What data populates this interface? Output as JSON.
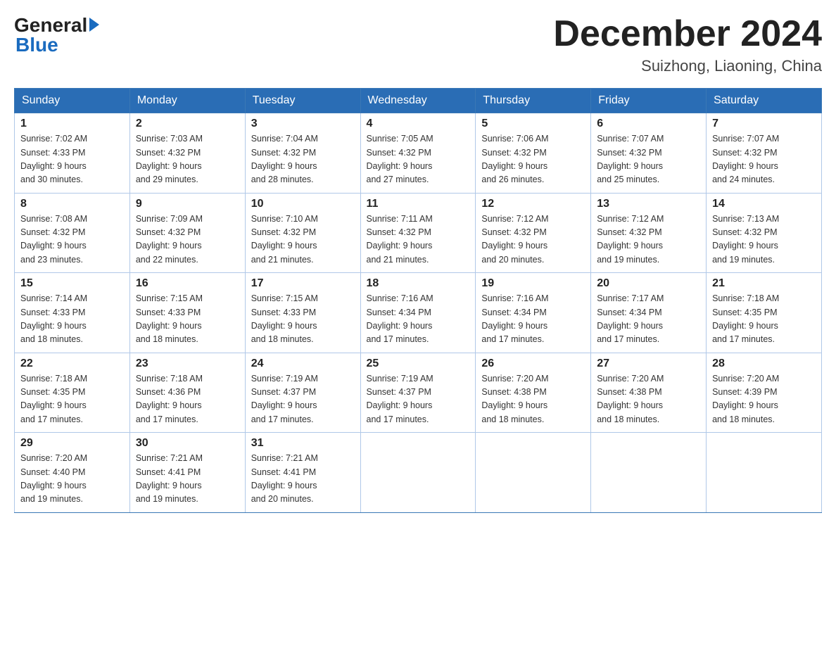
{
  "header": {
    "logo": {
      "general": "General",
      "blue": "Blue",
      "arrow": "▶"
    },
    "title": "December 2024",
    "location": "Suizhong, Liaoning, China"
  },
  "days_of_week": [
    "Sunday",
    "Monday",
    "Tuesday",
    "Wednesday",
    "Thursday",
    "Friday",
    "Saturday"
  ],
  "weeks": [
    [
      {
        "day": "1",
        "sunrise": "7:02 AM",
        "sunset": "4:33 PM",
        "daylight": "9 hours and 30 minutes."
      },
      {
        "day": "2",
        "sunrise": "7:03 AM",
        "sunset": "4:32 PM",
        "daylight": "9 hours and 29 minutes."
      },
      {
        "day": "3",
        "sunrise": "7:04 AM",
        "sunset": "4:32 PM",
        "daylight": "9 hours and 28 minutes."
      },
      {
        "day": "4",
        "sunrise": "7:05 AM",
        "sunset": "4:32 PM",
        "daylight": "9 hours and 27 minutes."
      },
      {
        "day": "5",
        "sunrise": "7:06 AM",
        "sunset": "4:32 PM",
        "daylight": "9 hours and 26 minutes."
      },
      {
        "day": "6",
        "sunrise": "7:07 AM",
        "sunset": "4:32 PM",
        "daylight": "9 hours and 25 minutes."
      },
      {
        "day": "7",
        "sunrise": "7:07 AM",
        "sunset": "4:32 PM",
        "daylight": "9 hours and 24 minutes."
      }
    ],
    [
      {
        "day": "8",
        "sunrise": "7:08 AM",
        "sunset": "4:32 PM",
        "daylight": "9 hours and 23 minutes."
      },
      {
        "day": "9",
        "sunrise": "7:09 AM",
        "sunset": "4:32 PM",
        "daylight": "9 hours and 22 minutes."
      },
      {
        "day": "10",
        "sunrise": "7:10 AM",
        "sunset": "4:32 PM",
        "daylight": "9 hours and 21 minutes."
      },
      {
        "day": "11",
        "sunrise": "7:11 AM",
        "sunset": "4:32 PM",
        "daylight": "9 hours and 21 minutes."
      },
      {
        "day": "12",
        "sunrise": "7:12 AM",
        "sunset": "4:32 PM",
        "daylight": "9 hours and 20 minutes."
      },
      {
        "day": "13",
        "sunrise": "7:12 AM",
        "sunset": "4:32 PM",
        "daylight": "9 hours and 19 minutes."
      },
      {
        "day": "14",
        "sunrise": "7:13 AM",
        "sunset": "4:32 PM",
        "daylight": "9 hours and 19 minutes."
      }
    ],
    [
      {
        "day": "15",
        "sunrise": "7:14 AM",
        "sunset": "4:33 PM",
        "daylight": "9 hours and 18 minutes."
      },
      {
        "day": "16",
        "sunrise": "7:15 AM",
        "sunset": "4:33 PM",
        "daylight": "9 hours and 18 minutes."
      },
      {
        "day": "17",
        "sunrise": "7:15 AM",
        "sunset": "4:33 PM",
        "daylight": "9 hours and 18 minutes."
      },
      {
        "day": "18",
        "sunrise": "7:16 AM",
        "sunset": "4:34 PM",
        "daylight": "9 hours and 17 minutes."
      },
      {
        "day": "19",
        "sunrise": "7:16 AM",
        "sunset": "4:34 PM",
        "daylight": "9 hours and 17 minutes."
      },
      {
        "day": "20",
        "sunrise": "7:17 AM",
        "sunset": "4:34 PM",
        "daylight": "9 hours and 17 minutes."
      },
      {
        "day": "21",
        "sunrise": "7:18 AM",
        "sunset": "4:35 PM",
        "daylight": "9 hours and 17 minutes."
      }
    ],
    [
      {
        "day": "22",
        "sunrise": "7:18 AM",
        "sunset": "4:35 PM",
        "daylight": "9 hours and 17 minutes."
      },
      {
        "day": "23",
        "sunrise": "7:18 AM",
        "sunset": "4:36 PM",
        "daylight": "9 hours and 17 minutes."
      },
      {
        "day": "24",
        "sunrise": "7:19 AM",
        "sunset": "4:37 PM",
        "daylight": "9 hours and 17 minutes."
      },
      {
        "day": "25",
        "sunrise": "7:19 AM",
        "sunset": "4:37 PM",
        "daylight": "9 hours and 17 minutes."
      },
      {
        "day": "26",
        "sunrise": "7:20 AM",
        "sunset": "4:38 PM",
        "daylight": "9 hours and 18 minutes."
      },
      {
        "day": "27",
        "sunrise": "7:20 AM",
        "sunset": "4:38 PM",
        "daylight": "9 hours and 18 minutes."
      },
      {
        "day": "28",
        "sunrise": "7:20 AM",
        "sunset": "4:39 PM",
        "daylight": "9 hours and 18 minutes."
      }
    ],
    [
      {
        "day": "29",
        "sunrise": "7:20 AM",
        "sunset": "4:40 PM",
        "daylight": "9 hours and 19 minutes."
      },
      {
        "day": "30",
        "sunrise": "7:21 AM",
        "sunset": "4:41 PM",
        "daylight": "9 hours and 19 minutes."
      },
      {
        "day": "31",
        "sunrise": "7:21 AM",
        "sunset": "4:41 PM",
        "daylight": "9 hours and 20 minutes."
      },
      null,
      null,
      null,
      null
    ]
  ],
  "labels": {
    "sunrise": "Sunrise:",
    "sunset": "Sunset:",
    "daylight": "Daylight:"
  }
}
